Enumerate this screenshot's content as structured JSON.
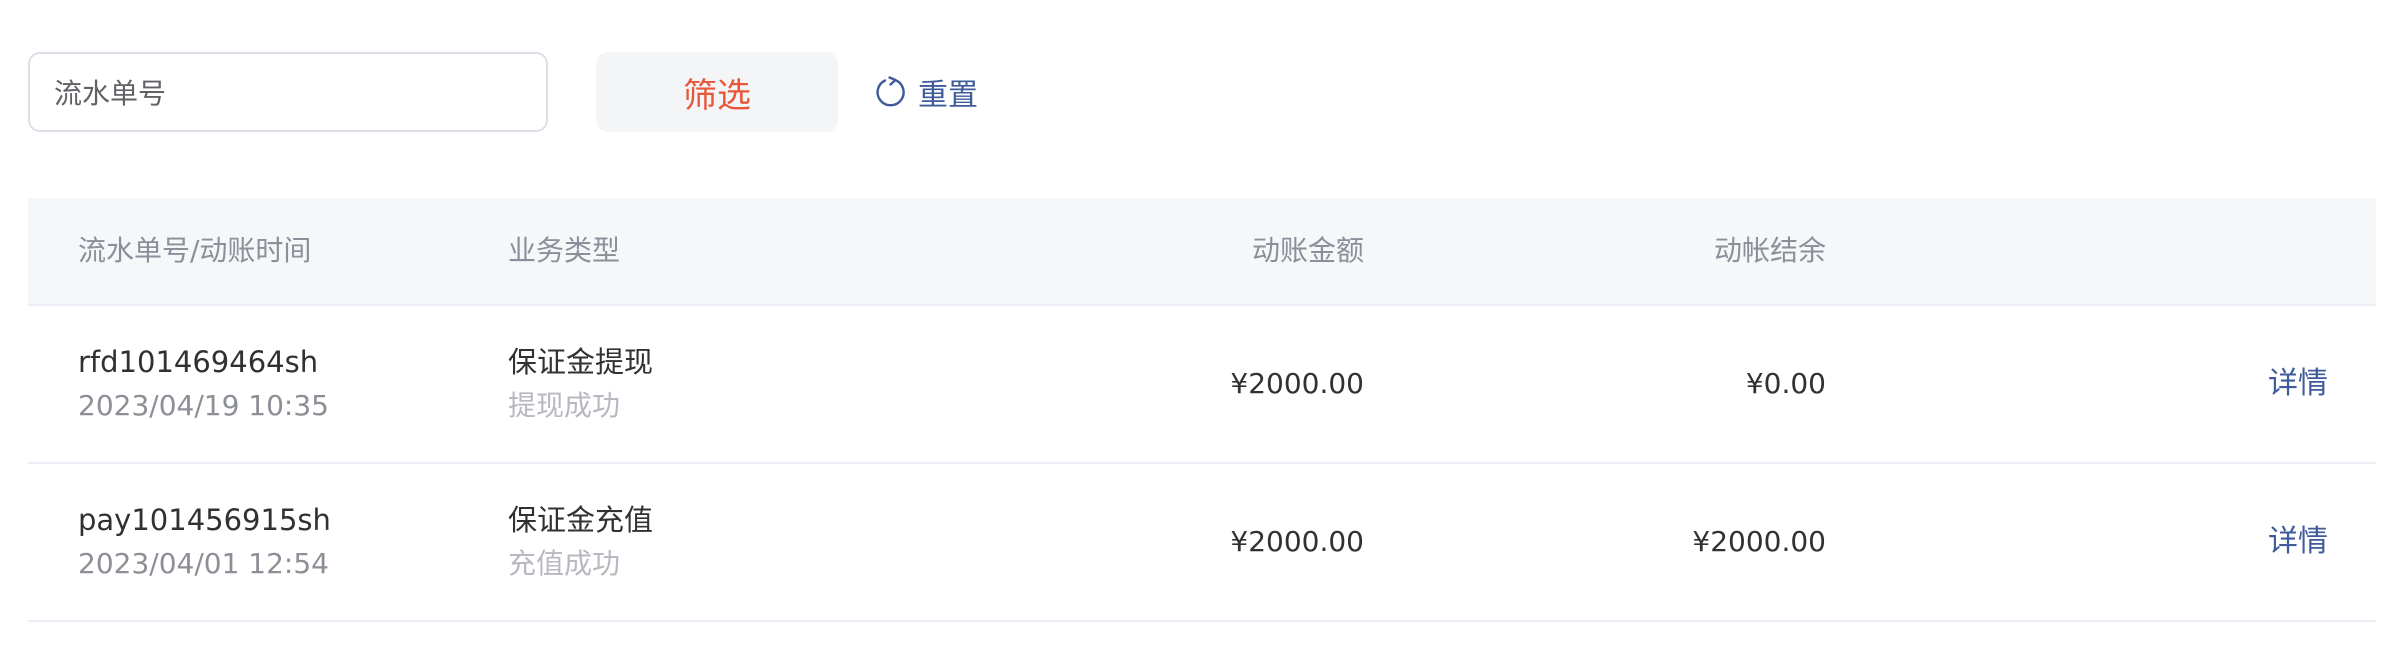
{
  "filter": {
    "search_label": "流水单号",
    "search_value": "",
    "filter_button": "筛选",
    "reset_label": "重置",
    "reset_icon": "refresh-icon",
    "accent_color": "#e8563a",
    "link_color": "#3f5b9a"
  },
  "table": {
    "headers": {
      "serial_time": "流水单号/动账时间",
      "business_type": "业务类型",
      "amount": "动账金额",
      "balance": "动帐结余"
    },
    "rows": [
      {
        "serial": "rfd101469464sh",
        "time": "2023/04/19 10:35",
        "type": "保证金提现",
        "status": "提现成功",
        "amount": "¥2000.00",
        "balance": "¥0.00",
        "action": "详情"
      },
      {
        "serial": "pay101456915sh",
        "time": "2023/04/01 12:54",
        "type": "保证金充值",
        "status": "充值成功",
        "amount": "¥2000.00",
        "balance": "¥2000.00",
        "action": "详情"
      }
    ]
  }
}
